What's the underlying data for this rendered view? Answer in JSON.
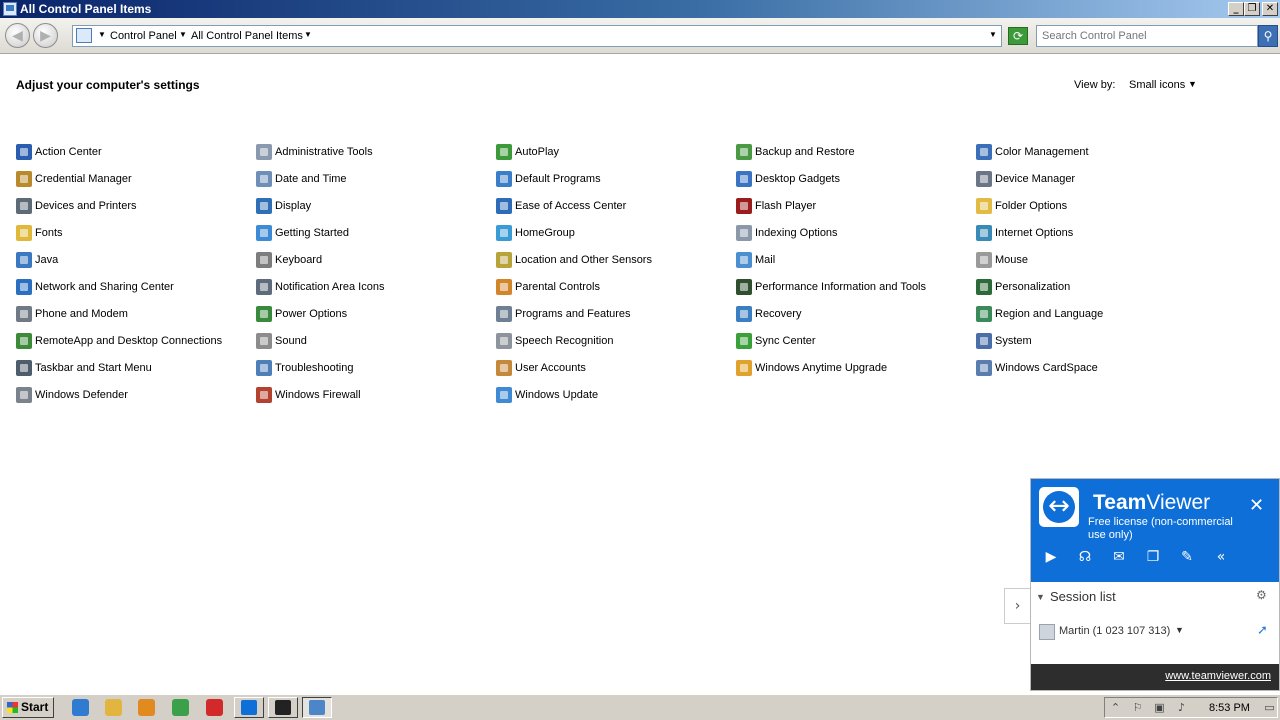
{
  "window": {
    "title": "All Control Panel Items"
  },
  "titlebar_buttons": [
    "_",
    "❐",
    "✕"
  ],
  "address": {
    "segments": [
      "Control Panel",
      "All Control Panel Items"
    ]
  },
  "search": {
    "placeholder": "Search Control Panel"
  },
  "main": {
    "heading": "Adjust your computer's settings",
    "view_by_label": "View by:",
    "view_by_value": "Small icons"
  },
  "columns": [
    [
      {
        "label": "Action Center",
        "icon": "flag-icon",
        "color": "#2a5db0"
      },
      {
        "label": "Credential Manager",
        "icon": "vault-icon",
        "color": "#b88a2c"
      },
      {
        "label": "Devices and Printers",
        "icon": "printer-icon",
        "color": "#5d6a78"
      },
      {
        "label": "Fonts",
        "icon": "folder-fonts-icon",
        "color": "#e0b93a"
      },
      {
        "label": "Java",
        "icon": "java-icon",
        "color": "#3b78c2"
      },
      {
        "label": "Network and Sharing Center",
        "icon": "network-icon",
        "color": "#2b6fc0"
      },
      {
        "label": "Phone and Modem",
        "icon": "phone-icon",
        "color": "#707a86"
      },
      {
        "label": "RemoteApp and Desktop Connections",
        "icon": "remoteapp-icon",
        "color": "#3c8a3a"
      },
      {
        "label": "Taskbar and Start Menu",
        "icon": "taskbar-icon",
        "color": "#4d5d6c"
      },
      {
        "label": "Windows Defender",
        "icon": "defender-icon",
        "color": "#7a828c"
      }
    ],
    [
      {
        "label": "Administrative Tools",
        "icon": "admin-tools-icon",
        "color": "#8a9aae"
      },
      {
        "label": "Date and Time",
        "icon": "calendar-icon",
        "color": "#6d8fb8"
      },
      {
        "label": "Display",
        "icon": "monitor-icon",
        "color": "#2f6fb6"
      },
      {
        "label": "Getting Started",
        "icon": "getting-started-icon",
        "color": "#3d8bd4"
      },
      {
        "label": "Keyboard",
        "icon": "keyboard-icon",
        "color": "#7d7d7d"
      },
      {
        "label": "Notification Area Icons",
        "icon": "notification-icon",
        "color": "#5d6b7c"
      },
      {
        "label": "Power Options",
        "icon": "power-icon",
        "color": "#3a8a3e"
      },
      {
        "label": "Sound",
        "icon": "speaker-icon",
        "color": "#8c8c8c"
      },
      {
        "label": "Troubleshooting",
        "icon": "troubleshoot-icon",
        "color": "#4f7fb8"
      },
      {
        "label": "Windows Firewall",
        "icon": "firewall-icon",
        "color": "#b3422f"
      }
    ],
    [
      {
        "label": "AutoPlay",
        "icon": "autoplay-icon",
        "color": "#3c9a3a"
      },
      {
        "label": "Default Programs",
        "icon": "default-programs-icon",
        "color": "#3a7dc8"
      },
      {
        "label": "Ease of Access Center",
        "icon": "ease-access-icon",
        "color": "#2e6cb8"
      },
      {
        "label": "HomeGroup",
        "icon": "homegroup-icon",
        "color": "#3a9bd6"
      },
      {
        "label": "Location and Other Sensors",
        "icon": "sensor-icon",
        "color": "#b8a23a"
      },
      {
        "label": "Parental Controls",
        "icon": "parental-icon",
        "color": "#d2862c"
      },
      {
        "label": "Programs and Features",
        "icon": "programs-icon",
        "color": "#6f7f94"
      },
      {
        "label": "Speech Recognition",
        "icon": "microphone-icon",
        "color": "#8d949c"
      },
      {
        "label": "User Accounts",
        "icon": "users-icon",
        "color": "#c4893a"
      },
      {
        "label": "Windows Update",
        "icon": "update-icon",
        "color": "#3f8ad2"
      }
    ],
    [
      {
        "label": "Backup and Restore",
        "icon": "backup-icon",
        "color": "#4a9a45"
      },
      {
        "label": "Desktop Gadgets",
        "icon": "gadgets-icon",
        "color": "#3a72c4"
      },
      {
        "label": "Flash Player",
        "icon": "flash-icon",
        "color": "#9b1c1c"
      },
      {
        "label": "Indexing Options",
        "icon": "indexing-icon",
        "color": "#8a98aa"
      },
      {
        "label": "Mail",
        "icon": "mail-icon",
        "color": "#4b8fd0"
      },
      {
        "label": "Performance Information and Tools",
        "icon": "performance-icon",
        "color": "#2f4f2f"
      },
      {
        "label": "Recovery",
        "icon": "recovery-icon",
        "color": "#3b7fc2"
      },
      {
        "label": "Sync Center",
        "icon": "sync-icon",
        "color": "#3aa03a"
      },
      {
        "label": "Windows Anytime Upgrade",
        "icon": "windows-logo-icon",
        "color": "#e0a22a"
      }
    ],
    [
      {
        "label": "Color Management",
        "icon": "color-mgmt-icon",
        "color": "#3b6fb8"
      },
      {
        "label": "Device Manager",
        "icon": "device-manager-icon",
        "color": "#6a7686"
      },
      {
        "label": "Folder Options",
        "icon": "folder-options-icon",
        "color": "#e2bb45"
      },
      {
        "label": "Internet Options",
        "icon": "internet-icon",
        "color": "#3a8ab8"
      },
      {
        "label": "Mouse",
        "icon": "mouse-icon",
        "color": "#9a9a9a"
      },
      {
        "label": "Personalization",
        "icon": "personalization-icon",
        "color": "#2d6a3a"
      },
      {
        "label": "Region and Language",
        "icon": "globe-icon",
        "color": "#3a8a5a"
      },
      {
        "label": "System",
        "icon": "system-icon",
        "color": "#4a6ea8"
      },
      {
        "label": "Windows CardSpace",
        "icon": "cardspace-icon",
        "color": "#5a7db0"
      }
    ]
  ],
  "teamviewer": {
    "brand_bold": "Team",
    "brand_regular": "Viewer",
    "license": "Free license (non-commercial use only)",
    "tools": [
      "▶",
      "☊",
      "✉",
      "❐",
      "✎",
      "«"
    ],
    "session_title": "Session list",
    "contact": "Martin (1 023 107 313)",
    "url": "www.teamviewer.com",
    "expand": "›"
  },
  "taskbar": {
    "start_label": "Start",
    "quick_launch": [
      {
        "icon": "ie-icon",
        "color": "#2f7bd2"
      },
      {
        "icon": "explorer-icon",
        "color": "#e2b540"
      },
      {
        "icon": "media-player-icon",
        "color": "#e08a20"
      },
      {
        "icon": "chrome-icon",
        "color": "#3aa14a"
      },
      {
        "icon": "opera-icon",
        "color": "#d22a2a"
      }
    ],
    "buttons": [
      {
        "icon": "teamviewer-task-icon",
        "color": "#0e6fd8"
      },
      {
        "icon": "cmd-task-icon",
        "color": "#222222"
      },
      {
        "icon": "control-panel-task-icon",
        "color": "#4d86c8"
      }
    ],
    "clock": "8:53 PM"
  }
}
